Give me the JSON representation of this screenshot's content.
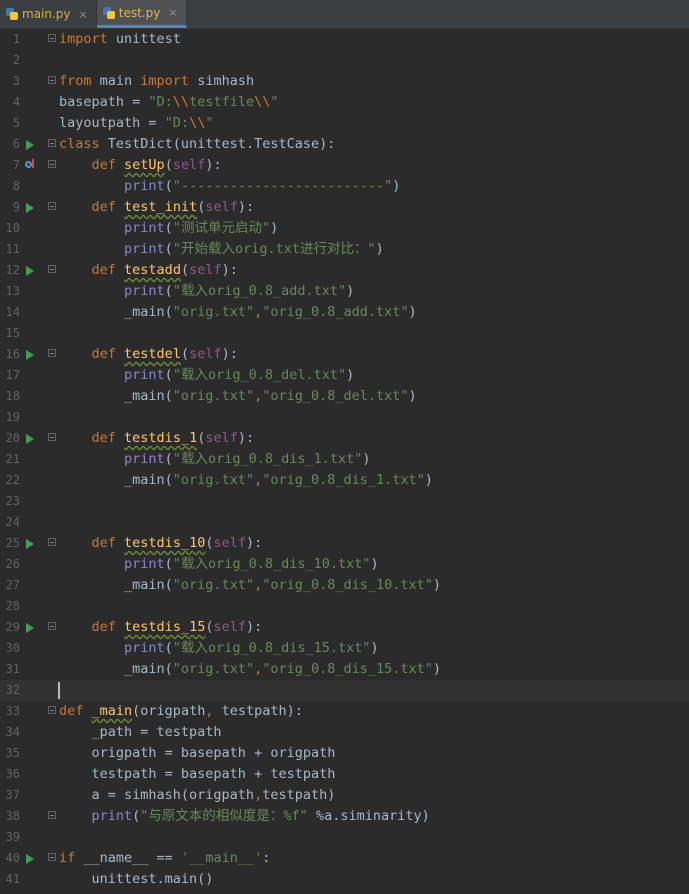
{
  "tabs": [
    {
      "label": "main.py",
      "active": false,
      "icon": "python-file-icon"
    },
    {
      "label": "test.py",
      "active": true,
      "icon": "python-file-icon"
    }
  ],
  "close_glyph": "×",
  "colors": {
    "background": "#2b2b2b",
    "keyword": "#cc7832",
    "string": "#6a8759",
    "function": "#ffc66d",
    "self": "#94558d",
    "text": "#a9b7c6",
    "run_gutter": "#499c54"
  },
  "current_line": 32,
  "lines": [
    {
      "n": "1",
      "fold": true,
      "tokens": [
        [
          "kw",
          "import"
        ],
        [
          "t",
          " unittest"
        ]
      ]
    },
    {
      "n": "2",
      "tokens": []
    },
    {
      "n": "3",
      "fold": true,
      "tokens": [
        [
          "kw",
          "from"
        ],
        [
          "t",
          " main "
        ],
        [
          "kw",
          "import"
        ],
        [
          "t",
          " simhash"
        ]
      ]
    },
    {
      "n": "4",
      "tokens": [
        [
          "t",
          "basepath = "
        ],
        [
          "st",
          "\"D:"
        ],
        [
          "esc",
          "\\\\"
        ],
        [
          "st",
          "testfile"
        ],
        [
          "esc",
          "\\\\"
        ],
        [
          "st",
          "\""
        ]
      ]
    },
    {
      "n": "5",
      "tokens": [
        [
          "t",
          "layoutpath = "
        ],
        [
          "st",
          "\"D:"
        ],
        [
          "esc",
          "\\\\"
        ],
        [
          "st",
          "\""
        ]
      ]
    },
    {
      "n": "6",
      "run": true,
      "fold": true,
      "tokens": [
        [
          "kw",
          "class"
        ],
        [
          "t",
          " TestDict(unittest.TestCase):"
        ]
      ]
    },
    {
      "n": "7",
      "override": true,
      "fold": true,
      "tokens": [
        [
          "t",
          "    "
        ],
        [
          "kw",
          "def"
        ],
        [
          "t",
          " "
        ],
        [
          "fn",
          "setUp"
        ],
        [
          "t",
          "("
        ],
        [
          "self",
          "self"
        ],
        [
          "t",
          "):"
        ]
      ]
    },
    {
      "n": "8",
      "tokens": [
        [
          "t",
          "        "
        ],
        [
          "bi",
          "print"
        ],
        [
          "t",
          "("
        ],
        [
          "st",
          "\"-------------------------\""
        ],
        [
          "t",
          ")"
        ]
      ]
    },
    {
      "n": "9",
      "run": true,
      "fold": true,
      "tokens": [
        [
          "t",
          "    "
        ],
        [
          "kw",
          "def"
        ],
        [
          "t",
          " "
        ],
        [
          "fn",
          "test_init"
        ],
        [
          "t",
          "("
        ],
        [
          "self",
          "self"
        ],
        [
          "t",
          "):"
        ]
      ]
    },
    {
      "n": "10",
      "tokens": [
        [
          "t",
          "        "
        ],
        [
          "bi",
          "print"
        ],
        [
          "t",
          "("
        ],
        [
          "st",
          "\"测试单元启动\""
        ],
        [
          "t",
          ")"
        ]
      ]
    },
    {
      "n": "11",
      "tokens": [
        [
          "t",
          "        "
        ],
        [
          "bi",
          "print"
        ],
        [
          "t",
          "("
        ],
        [
          "st",
          "\"开始载入orig.txt进行对比：\""
        ],
        [
          "t",
          ")"
        ]
      ]
    },
    {
      "n": "12",
      "run": true,
      "fold": true,
      "tokens": [
        [
          "t",
          "    "
        ],
        [
          "kw",
          "def"
        ],
        [
          "t",
          " "
        ],
        [
          "fn",
          "testadd"
        ],
        [
          "t",
          "("
        ],
        [
          "self",
          "self"
        ],
        [
          "t",
          "):"
        ]
      ]
    },
    {
      "n": "13",
      "tokens": [
        [
          "t",
          "        "
        ],
        [
          "bi",
          "print"
        ],
        [
          "t",
          "("
        ],
        [
          "st",
          "\"载入orig_0.8_add.txt\""
        ],
        [
          "t",
          ")"
        ]
      ]
    },
    {
      "n": "14",
      "tokens": [
        [
          "t",
          "        _main("
        ],
        [
          "st",
          "\"orig.txt\""
        ],
        [
          "kw",
          ","
        ],
        [
          "st",
          "\"orig_0.8_add.txt\""
        ],
        [
          "t",
          ")"
        ]
      ]
    },
    {
      "n": "15",
      "tokens": []
    },
    {
      "n": "16",
      "run": true,
      "fold": true,
      "tokens": [
        [
          "t",
          "    "
        ],
        [
          "kw",
          "def"
        ],
        [
          "t",
          " "
        ],
        [
          "fn",
          "testdel"
        ],
        [
          "t",
          "("
        ],
        [
          "self",
          "self"
        ],
        [
          "t",
          "):"
        ]
      ]
    },
    {
      "n": "17",
      "tokens": [
        [
          "t",
          "        "
        ],
        [
          "bi",
          "print"
        ],
        [
          "t",
          "("
        ],
        [
          "st",
          "\"载入orig_0.8_del.txt\""
        ],
        [
          "t",
          ")"
        ]
      ]
    },
    {
      "n": "18",
      "tokens": [
        [
          "t",
          "        _main("
        ],
        [
          "st",
          "\"orig.txt\""
        ],
        [
          "kw",
          ","
        ],
        [
          "st",
          "\"orig_0.8_del.txt\""
        ],
        [
          "t",
          ")"
        ]
      ]
    },
    {
      "n": "19",
      "tokens": []
    },
    {
      "n": "20",
      "run": true,
      "fold": true,
      "tokens": [
        [
          "t",
          "    "
        ],
        [
          "kw",
          "def"
        ],
        [
          "t",
          " "
        ],
        [
          "fn",
          "testdis_1"
        ],
        [
          "t",
          "("
        ],
        [
          "self",
          "self"
        ],
        [
          "t",
          "):"
        ]
      ]
    },
    {
      "n": "21",
      "tokens": [
        [
          "t",
          "        "
        ],
        [
          "bi",
          "print"
        ],
        [
          "t",
          "("
        ],
        [
          "st",
          "\"载入orig_0.8_dis_1.txt\""
        ],
        [
          "t",
          ")"
        ]
      ]
    },
    {
      "n": "22",
      "tokens": [
        [
          "t",
          "        _main("
        ],
        [
          "st",
          "\"orig.txt\""
        ],
        [
          "kw",
          ","
        ],
        [
          "st",
          "\"orig_0.8_dis_1.txt\""
        ],
        [
          "t",
          ")"
        ]
      ]
    },
    {
      "n": "23",
      "tokens": []
    },
    {
      "n": "24",
      "tokens": []
    },
    {
      "n": "25",
      "run": true,
      "fold": true,
      "tokens": [
        [
          "t",
          "    "
        ],
        [
          "kw",
          "def"
        ],
        [
          "t",
          " "
        ],
        [
          "fn",
          "testdis_10"
        ],
        [
          "t",
          "("
        ],
        [
          "self",
          "self"
        ],
        [
          "t",
          "):"
        ]
      ]
    },
    {
      "n": "26",
      "tokens": [
        [
          "t",
          "        "
        ],
        [
          "bi",
          "print"
        ],
        [
          "t",
          "("
        ],
        [
          "st",
          "\"载入orig_0.8_dis_10.txt\""
        ],
        [
          "t",
          ")"
        ]
      ]
    },
    {
      "n": "27",
      "tokens": [
        [
          "t",
          "        _main("
        ],
        [
          "st",
          "\"orig.txt\""
        ],
        [
          "kw",
          ","
        ],
        [
          "st",
          "\"orig_0.8_dis_10.txt\""
        ],
        [
          "t",
          ")"
        ]
      ]
    },
    {
      "n": "28",
      "tokens": []
    },
    {
      "n": "29",
      "run": true,
      "fold": true,
      "tokens": [
        [
          "t",
          "    "
        ],
        [
          "kw",
          "def"
        ],
        [
          "t",
          " "
        ],
        [
          "fn",
          "testdis_15"
        ],
        [
          "t",
          "("
        ],
        [
          "self",
          "self"
        ],
        [
          "t",
          "):"
        ]
      ]
    },
    {
      "n": "30",
      "tokens": [
        [
          "t",
          "        "
        ],
        [
          "bi",
          "print"
        ],
        [
          "t",
          "("
        ],
        [
          "st",
          "\"载入orig_0.8_dis_15.txt\""
        ],
        [
          "t",
          ")"
        ]
      ]
    },
    {
      "n": "31",
      "tokens": [
        [
          "t",
          "        _main("
        ],
        [
          "st",
          "\"orig.txt\""
        ],
        [
          "kw",
          ","
        ],
        [
          "st",
          "\"orig_0.8_dis_15.txt\""
        ],
        [
          "t",
          ")"
        ]
      ]
    },
    {
      "n": "32",
      "tokens": []
    },
    {
      "n": "33",
      "fold": true,
      "tokens": [
        [
          "kw",
          "def"
        ],
        [
          "t",
          " "
        ],
        [
          "fn",
          "_main"
        ],
        [
          "t",
          "(origpath"
        ],
        [
          "kw",
          ","
        ],
        [
          "t",
          " testpath):"
        ]
      ]
    },
    {
      "n": "34",
      "tokens": [
        [
          "t",
          "    _path = testpath"
        ]
      ]
    },
    {
      "n": "35",
      "tokens": [
        [
          "t",
          "    origpath = basepath + origpath"
        ]
      ]
    },
    {
      "n": "36",
      "tokens": [
        [
          "t",
          "    testpath = basepath + testpath"
        ]
      ]
    },
    {
      "n": "37",
      "tokens": [
        [
          "t",
          "    a = simhash(origpath"
        ],
        [
          "kw",
          ","
        ],
        [
          "t",
          "testpath)"
        ]
      ]
    },
    {
      "n": "38",
      "fold": true,
      "tokens": [
        [
          "t",
          "    "
        ],
        [
          "bi",
          "print"
        ],
        [
          "t",
          "("
        ],
        [
          "st",
          "\"与原文本的相似度是：%f\""
        ],
        [
          "t",
          " %a.siminarity)"
        ]
      ]
    },
    {
      "n": "39",
      "tokens": []
    },
    {
      "n": "40",
      "run": true,
      "fold": true,
      "tokens": [
        [
          "kw",
          "if"
        ],
        [
          "t",
          " __name__ == "
        ],
        [
          "st",
          "'__main__'"
        ],
        [
          "t",
          ":"
        ]
      ]
    },
    {
      "n": "41",
      "tokens": [
        [
          "t",
          "    unittest.main()"
        ]
      ]
    }
  ]
}
